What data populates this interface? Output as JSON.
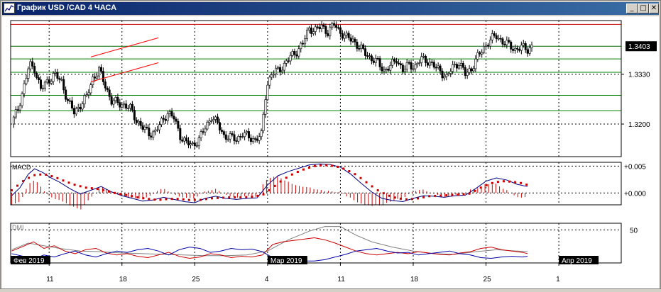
{
  "window": {
    "title": "График USD /CAD  4 ЧАСА",
    "controls": {
      "minimize": "_",
      "maximize": "□",
      "close": "✕"
    },
    "icon": "chart-window-icon"
  },
  "chart_data": {
    "type": "candlestick",
    "symbol": "USD/CAD",
    "timeframe": "4 ЧАСА",
    "current_price_label": "1.3403",
    "price_axis_ticks": [
      "1.3330",
      "1.3200"
    ],
    "price_axis_tick_values": [
      1.333,
      1.32
    ],
    "ylim": [
      1.3115,
      1.347
    ],
    "horizontal_levels": [
      {
        "price": 1.346,
        "color": "#cc0000"
      },
      {
        "price": 1.3403,
        "color": "#006600"
      },
      {
        "price": 1.337,
        "color": "#008000"
      },
      {
        "price": 1.3335,
        "color": "#008000"
      },
      {
        "price": 1.3275,
        "color": "#008000"
      },
      {
        "price": 1.3235,
        "color": "#008000"
      }
    ],
    "channel_lines": [
      {
        "color": "#ff0000",
        "points": [
          [
            15.0,
            1.3375
          ],
          [
            21.5,
            1.3425
          ]
        ]
      },
      {
        "color": "#ff0000",
        "points": [
          [
            15.0,
            1.331
          ],
          [
            21.5,
            1.336
          ]
        ]
      }
    ],
    "x_axis_ticks": [
      {
        "label": "11",
        "day": 11
      },
      {
        "label": "18",
        "day": 18
      },
      {
        "label": "25",
        "day": 25
      },
      {
        "label": "4",
        "day": 32
      },
      {
        "label": "11",
        "day": 39
      },
      {
        "label": "18",
        "day": 46
      },
      {
        "label": "25",
        "day": 53
      },
      {
        "label": "1",
        "day": 60
      }
    ],
    "month_labels": [
      {
        "label": "Фев 2019",
        "day": 7.3
      },
      {
        "label": "Мар 2019",
        "day": 32
      },
      {
        "label": "Апр 2019",
        "day": 60
      }
    ],
    "x_range_days": [
      7.3,
      66
    ],
    "close_path": [
      [
        7.4,
        1.32
      ],
      [
        8.0,
        1.324
      ],
      [
        8.6,
        1.33
      ],
      [
        9.1,
        1.3355
      ],
      [
        9.6,
        1.3345
      ],
      [
        10.2,
        1.329
      ],
      [
        10.8,
        1.331
      ],
      [
        11.5,
        1.333
      ],
      [
        12.2,
        1.331
      ],
      [
        12.8,
        1.326
      ],
      [
        13.4,
        1.323
      ],
      [
        14.0,
        1.325
      ],
      [
        14.6,
        1.327
      ],
      [
        15.2,
        1.332
      ],
      [
        15.8,
        1.334
      ],
      [
        16.4,
        1.33
      ],
      [
        17.0,
        1.326
      ],
      [
        17.6,
        1.3255
      ],
      [
        18.2,
        1.325
      ],
      [
        18.8,
        1.324
      ],
      [
        19.4,
        1.321
      ],
      [
        20.0,
        1.319
      ],
      [
        20.6,
        1.3175
      ],
      [
        21.2,
        1.318
      ],
      [
        21.8,
        1.3205
      ],
      [
        22.4,
        1.323
      ],
      [
        23.0,
        1.3215
      ],
      [
        23.6,
        1.317
      ],
      [
        24.2,
        1.315
      ],
      [
        24.8,
        1.3145
      ],
      [
        25.4,
        1.316
      ],
      [
        26.0,
        1.319
      ],
      [
        26.6,
        1.322
      ],
      [
        27.2,
        1.32
      ],
      [
        27.8,
        1.317
      ],
      [
        28.4,
        1.3165
      ],
      [
        29.0,
        1.316
      ],
      [
        29.6,
        1.3175
      ],
      [
        30.2,
        1.3165
      ],
      [
        30.8,
        1.316
      ],
      [
        31.4,
        1.317
      ],
      [
        31.9,
        1.33
      ],
      [
        32.4,
        1.333
      ],
      [
        33.0,
        1.334
      ],
      [
        33.6,
        1.3355
      ],
      [
        34.2,
        1.3375
      ],
      [
        34.8,
        1.339
      ],
      [
        35.4,
        1.341
      ],
      [
        36.0,
        1.345
      ],
      [
        36.6,
        1.3445
      ],
      [
        37.2,
        1.3455
      ],
      [
        37.8,
        1.344
      ],
      [
        38.4,
        1.346
      ],
      [
        39.0,
        1.344
      ],
      [
        39.6,
        1.3425
      ],
      [
        40.2,
        1.342
      ],
      [
        40.8,
        1.34
      ],
      [
        41.4,
        1.3385
      ],
      [
        42.0,
        1.337
      ],
      [
        42.6,
        1.336
      ],
      [
        43.2,
        1.334
      ],
      [
        43.8,
        1.335
      ],
      [
        44.4,
        1.337
      ],
      [
        45.0,
        1.334
      ],
      [
        45.6,
        1.3355
      ],
      [
        46.2,
        1.335
      ],
      [
        46.8,
        1.337
      ],
      [
        47.4,
        1.3365
      ],
      [
        48.0,
        1.335
      ],
      [
        48.6,
        1.334
      ],
      [
        49.2,
        1.332
      ],
      [
        49.8,
        1.335
      ],
      [
        50.4,
        1.336
      ],
      [
        51.0,
        1.333
      ],
      [
        51.6,
        1.3345
      ],
      [
        52.2,
        1.3375
      ],
      [
        52.8,
        1.34
      ],
      [
        53.4,
        1.342
      ],
      [
        54.0,
        1.343
      ],
      [
        54.6,
        1.3415
      ],
      [
        55.2,
        1.3405
      ],
      [
        55.8,
        1.3395
      ],
      [
        56.4,
        1.34
      ],
      [
        57.0,
        1.3395
      ],
      [
        57.4,
        1.3403
      ]
    ],
    "macd": {
      "label": "MACD",
      "axis_ticks": [
        "+0.005",
        "+0.000"
      ],
      "axis_tick_values": [
        0.005,
        0.0
      ],
      "ylim": [
        -0.0022,
        0.0057
      ],
      "main_line": [
        [
          7.4,
          -0.0005
        ],
        [
          8.2,
          0.001
        ],
        [
          9.0,
          0.0035
        ],
        [
          9.6,
          0.0045
        ],
        [
          10.4,
          0.0038
        ],
        [
          11.2,
          0.0028
        ],
        [
          12.0,
          0.002
        ],
        [
          13.0,
          0.0008
        ],
        [
          14.0,
          -0.0002
        ],
        [
          15.0,
          0.0005
        ],
        [
          16.0,
          0.0012
        ],
        [
          17.0,
          0.0002
        ],
        [
          18.0,
          -0.0005
        ],
        [
          19.0,
          -0.001
        ],
        [
          20.0,
          -0.0015
        ],
        [
          21.0,
          -0.0013
        ],
        [
          22.0,
          -0.0008
        ],
        [
          23.0,
          -0.0012
        ],
        [
          24.0,
          -0.0016
        ],
        [
          25.0,
          -0.0018
        ],
        [
          26.0,
          -0.001
        ],
        [
          27.0,
          -0.0006
        ],
        [
          28.0,
          -0.001
        ],
        [
          29.0,
          -0.0012
        ],
        [
          30.0,
          -0.001
        ],
        [
          31.0,
          -0.0009
        ],
        [
          32.0,
          0.0015
        ],
        [
          33.0,
          0.0032
        ],
        [
          34.0,
          0.004
        ],
        [
          35.0,
          0.0046
        ],
        [
          36.0,
          0.0052
        ],
        [
          37.0,
          0.0054
        ],
        [
          38.0,
          0.0053
        ],
        [
          39.0,
          0.0048
        ],
        [
          40.0,
          0.0035
        ],
        [
          41.0,
          0.0018
        ],
        [
          42.0,
          0.0002
        ],
        [
          43.0,
          -0.001
        ],
        [
          44.0,
          -0.0014
        ],
        [
          45.0,
          -0.0016
        ],
        [
          46.0,
          -0.001
        ],
        [
          47.0,
          -0.0005
        ],
        [
          48.0,
          -0.0006
        ],
        [
          49.0,
          -0.0008
        ],
        [
          50.0,
          -0.0005
        ],
        [
          51.0,
          -0.0004
        ],
        [
          52.0,
          0.0008
        ],
        [
          53.0,
          0.0022
        ],
        [
          54.0,
          0.0028
        ],
        [
          55.0,
          0.0024
        ],
        [
          56.0,
          0.0016
        ],
        [
          57.0,
          0.0012
        ]
      ],
      "signal_line": [
        [
          7.4,
          0.0005
        ],
        [
          8.5,
          0.0022
        ],
        [
          9.5,
          0.0033
        ],
        [
          10.5,
          0.0035
        ],
        [
          11.5,
          0.003
        ],
        [
          12.5,
          0.0022
        ],
        [
          13.5,
          0.0015
        ],
        [
          14.5,
          0.001
        ],
        [
          15.5,
          0.0008
        ],
        [
          16.5,
          0.0004
        ],
        [
          17.5,
          -0.0001
        ],
        [
          18.5,
          -0.0004
        ],
        [
          19.5,
          -0.0008
        ],
        [
          20.5,
          -0.0011
        ],
        [
          21.5,
          -0.0013
        ],
        [
          22.5,
          -0.0011
        ],
        [
          23.5,
          -0.0011
        ],
        [
          24.5,
          -0.0013
        ],
        [
          25.5,
          -0.0013
        ],
        [
          26.5,
          -0.001
        ],
        [
          27.5,
          -0.0009
        ],
        [
          28.5,
          -0.0008
        ],
        [
          29.5,
          -0.0008
        ],
        [
          30.5,
          -0.0007
        ],
        [
          31.5,
          -0.0004
        ],
        [
          32.5,
          0.001
        ],
        [
          33.5,
          0.0025
        ],
        [
          34.5,
          0.0036
        ],
        [
          35.5,
          0.0044
        ],
        [
          36.5,
          0.005
        ],
        [
          37.5,
          0.0052
        ],
        [
          38.5,
          0.005
        ],
        [
          39.5,
          0.0044
        ],
        [
          40.5,
          0.0034
        ],
        [
          41.5,
          0.002
        ],
        [
          42.5,
          0.0006
        ],
        [
          43.5,
          -0.0004
        ],
        [
          44.5,
          -0.001
        ],
        [
          45.5,
          -0.0012
        ],
        [
          46.5,
          -0.001
        ],
        [
          47.5,
          -0.0006
        ],
        [
          48.5,
          -0.0005
        ],
        [
          49.5,
          -0.0004
        ],
        [
          50.5,
          -0.0003
        ],
        [
          51.5,
          -0.0001
        ],
        [
          52.5,
          0.001
        ],
        [
          53.5,
          0.0018
        ],
        [
          54.5,
          0.0022
        ],
        [
          55.5,
          0.0021
        ],
        [
          56.5,
          0.0018
        ],
        [
          57.0,
          0.0015
        ]
      ]
    },
    "dmi": {
      "label": "DMI",
      "axis_ticks": [
        "50"
      ],
      "axis_tick_values": [
        50
      ],
      "ylim": [
        0,
        60
      ],
      "adx": [
        [
          7.4,
          20
        ],
        [
          9.0,
          30
        ],
        [
          10.5,
          26
        ],
        [
          12.0,
          22
        ],
        [
          14.0,
          18
        ],
        [
          16.0,
          17
        ],
        [
          18.0,
          15
        ],
        [
          20.0,
          14
        ],
        [
          22.0,
          13
        ],
        [
          24.0,
          12
        ],
        [
          26.0,
          11
        ],
        [
          28.0,
          11
        ],
        [
          30.0,
          12
        ],
        [
          32.0,
          18
        ],
        [
          34.0,
          35
        ],
        [
          36.0,
          48
        ],
        [
          37.5,
          55
        ],
        [
          39.0,
          55
        ],
        [
          40.5,
          42
        ],
        [
          42.0,
          32
        ],
        [
          44.0,
          24
        ],
        [
          46.0,
          18
        ],
        [
          48.0,
          14
        ],
        [
          50.0,
          13
        ],
        [
          52.0,
          17
        ],
        [
          54.0,
          20
        ],
        [
          56.0,
          18
        ],
        [
          57.0,
          17
        ]
      ],
      "plus_di": [
        [
          7.4,
          18
        ],
        [
          8.5,
          25
        ],
        [
          9.5,
          32
        ],
        [
          10.5,
          22
        ],
        [
          11.5,
          26
        ],
        [
          12.5,
          18
        ],
        [
          13.5,
          14
        ],
        [
          14.5,
          20
        ],
        [
          15.5,
          22
        ],
        [
          16.5,
          15
        ],
        [
          17.5,
          12
        ],
        [
          18.5,
          14
        ],
        [
          19.5,
          10
        ],
        [
          20.5,
          8
        ],
        [
          21.5,
          12
        ],
        [
          22.5,
          16
        ],
        [
          23.5,
          10
        ],
        [
          24.5,
          7
        ],
        [
          25.5,
          9
        ],
        [
          26.5,
          14
        ],
        [
          27.5,
          12
        ],
        [
          28.5,
          8
        ],
        [
          29.5,
          10
        ],
        [
          30.5,
          9
        ],
        [
          31.5,
          12
        ],
        [
          32.5,
          28
        ],
        [
          33.5,
          32
        ],
        [
          34.5,
          34
        ],
        [
          35.5,
          36
        ],
        [
          36.5,
          38
        ],
        [
          37.5,
          35
        ],
        [
          38.5,
          30
        ],
        [
          39.5,
          24
        ],
        [
          40.5,
          18
        ],
        [
          41.5,
          14
        ],
        [
          42.5,
          12
        ],
        [
          43.5,
          14
        ],
        [
          44.5,
          16
        ],
        [
          45.5,
          14
        ],
        [
          46.5,
          17
        ],
        [
          47.5,
          15
        ],
        [
          48.5,
          13
        ],
        [
          49.5,
          12
        ],
        [
          50.5,
          15
        ],
        [
          51.5,
          17
        ],
        [
          52.5,
          22
        ],
        [
          53.5,
          24
        ],
        [
          54.5,
          20
        ],
        [
          55.5,
          18
        ],
        [
          56.5,
          16
        ],
        [
          57.0,
          14
        ]
      ],
      "minus_di": [
        [
          7.4,
          14
        ],
        [
          8.5,
          10
        ],
        [
          9.5,
          6
        ],
        [
          10.5,
          12
        ],
        [
          11.5,
          9
        ],
        [
          12.5,
          14
        ],
        [
          13.5,
          18
        ],
        [
          14.5,
          12
        ],
        [
          15.5,
          9
        ],
        [
          16.5,
          14
        ],
        [
          17.5,
          18
        ],
        [
          18.5,
          16
        ],
        [
          19.5,
          20
        ],
        [
          20.5,
          22
        ],
        [
          21.5,
          18
        ],
        [
          22.5,
          12
        ],
        [
          23.5,
          20
        ],
        [
          24.5,
          24
        ],
        [
          25.5,
          22
        ],
        [
          26.5,
          16
        ],
        [
          27.5,
          18
        ],
        [
          28.5,
          22
        ],
        [
          29.5,
          20
        ],
        [
          30.5,
          21
        ],
        [
          31.5,
          17
        ],
        [
          32.5,
          8
        ],
        [
          33.5,
          5
        ],
        [
          34.5,
          4
        ],
        [
          35.5,
          3
        ],
        [
          36.5,
          3
        ],
        [
          37.5,
          5
        ],
        [
          38.5,
          9
        ],
        [
          39.5,
          13
        ],
        [
          40.5,
          18
        ],
        [
          41.5,
          20
        ],
        [
          42.5,
          22
        ],
        [
          43.5,
          18
        ],
        [
          44.5,
          15
        ],
        [
          45.5,
          16
        ],
        [
          46.5,
          12
        ],
        [
          47.5,
          14
        ],
        [
          48.5,
          16
        ],
        [
          49.5,
          18
        ],
        [
          50.5,
          14
        ],
        [
          51.5,
          12
        ],
        [
          52.5,
          8
        ],
        [
          53.5,
          7
        ],
        [
          54.5,
          9
        ],
        [
          55.5,
          10
        ],
        [
          56.5,
          9
        ],
        [
          57.0,
          10
        ]
      ]
    },
    "colors": {
      "up_candle": "#000000",
      "macd_main": "#000080",
      "macd_signal": "#cc0000",
      "macd_hist": "#cc0000",
      "dmi_adx": "#808080",
      "dmi_plus": "#cc0000",
      "dmi_minus": "#0000aa",
      "grid": "#000000",
      "price_label_bg": "#000000",
      "price_label_fg": "#ffffff"
    }
  }
}
